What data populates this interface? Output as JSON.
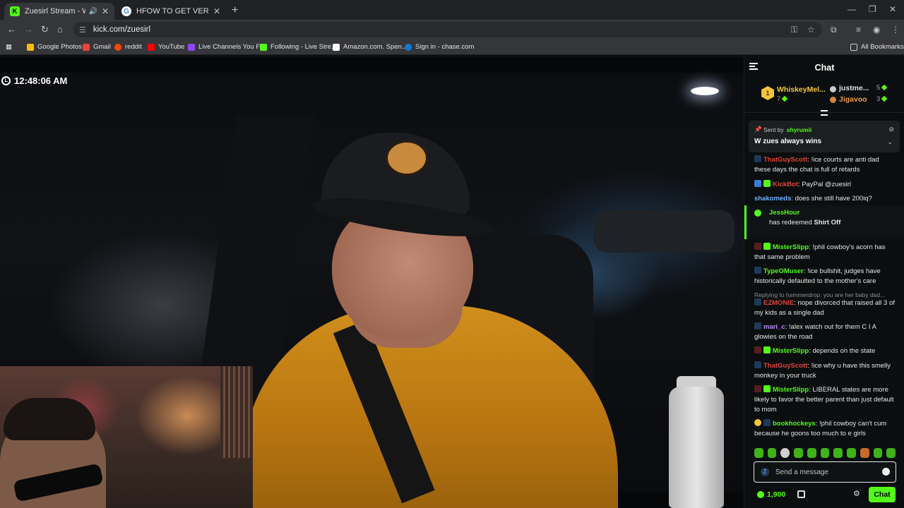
{
  "browser": {
    "tabs": [
      {
        "title": "Zuesirl Stream - Watch Live",
        "active": true
      },
      {
        "title": "HFOW TO GET VERIFIED ON KI",
        "active": false
      }
    ],
    "url": "kick.com/zuesirl",
    "bookmarks": [
      "Google Photos",
      "Gmail",
      "reddit",
      "YouTube",
      "Live Channels You F...",
      "Following - Live Stre...",
      "Amazon.com. Spen...",
      "Sign in - chase.com"
    ],
    "all_bookmarks": "All Bookmarks"
  },
  "player": {
    "timestamp": "12:48:06 AM"
  },
  "chat": {
    "title": "Chat",
    "leaderboard": {
      "first": {
        "rank": "1",
        "name": "WhiskeyMel...",
        "count": "7"
      },
      "second": {
        "name": "justme...",
        "count": "5"
      },
      "third": {
        "name": "Jigavoo",
        "count": "3"
      }
    },
    "pinned": {
      "sent_by_label": "Sent by",
      "sender": "shyrumii",
      "message": "W zues always wins"
    },
    "messages": [
      {
        "user": "ThatGuyScott",
        "color": "#e0433a",
        "text": "!ice courts are anti dad these days the chat is full of retards"
      },
      {
        "user": "KickBot",
        "color": "#e0433a",
        "text": "PayPal @zuesirl"
      },
      {
        "user": "shakomeds",
        "color": "#6fb0ff",
        "text": "does she still have 200iq?"
      },
      {
        "user": "MisterSlipp",
        "color": "#53fc18",
        "text": "!phil cowboy's acorn has that same problem"
      },
      {
        "user": "TypeOMuser",
        "color": "#53fc18",
        "text": "!ice bullshit, judges have historically defaulted to the mother's care"
      },
      {
        "user": "EZMONIE",
        "color": "#e0433a",
        "text": "nope divorced that raised all 3 of my kids as a single dad"
      },
      {
        "user": "mari_c",
        "color": "#b98bff",
        "text": "!alex watch out for them C I A glowies on the road"
      },
      {
        "user": "MisterSlipp",
        "color": "#53fc18",
        "text": "depends on the state"
      },
      {
        "user": "ThatGuyScott",
        "color": "#e0433a",
        "text": "!ice why u have this smelly monkey in your truck"
      },
      {
        "user": "MisterSlipp",
        "color": "#53fc18",
        "text": "LIBERAL states are more likely to favor the better parent than just default to mom"
      },
      {
        "user": "bookhockeys",
        "color": "#53fc18",
        "text": "!phil cowboy can't cum because he goons too much to e girls"
      }
    ],
    "redeem": {
      "user": "JessHour",
      "prefix": "has redeemed",
      "reward": "Shirt Off"
    },
    "reply_hint": "Replying to hammerdrop: you are her baby dad...",
    "input_placeholder": "Send a message",
    "points": "1,900",
    "send_label": "Chat"
  }
}
